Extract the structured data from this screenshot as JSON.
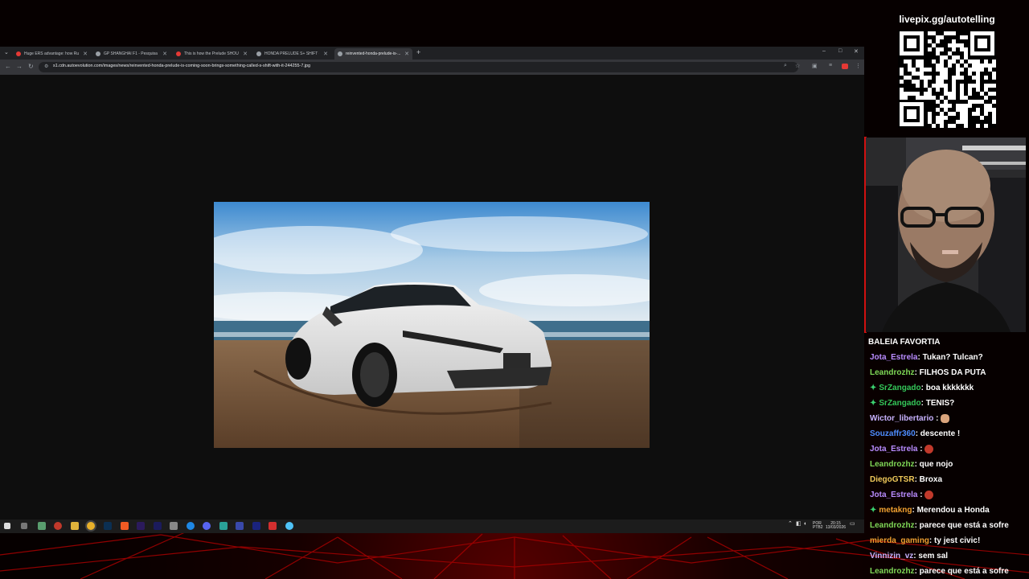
{
  "browser": {
    "tabs": [
      {
        "title": "Huge ERS advantage: how Ru...",
        "fav": "#e53935"
      },
      {
        "title": "GP SHANGHAI F1 - Pesquisa G...",
        "fav": "#9aa0a6"
      },
      {
        "title": "This is how the Prelude SHOU...",
        "fav": "#e53935"
      },
      {
        "title": "HONDA PRELUDE S+ SHIFT - F...",
        "fav": "#9aa0a6"
      },
      {
        "title": "reinvented-honda-prelude-is-...",
        "fav": "#9aa0a6"
      }
    ],
    "new_tab": "+",
    "url": "s1.cdn.autoevolution.com/images/news/reinvented-honda-prelude-is-coming-soon-brings-something-called-s-shift-with-it-244255-7.jpg",
    "window": {
      "minimize": "–",
      "maximize": "□",
      "close": "✕"
    }
  },
  "taskbar": {
    "lang": "POR",
    "lang2": "PTB2",
    "time": "20:15",
    "date": "13/03/2026"
  },
  "overlay": {
    "livepix": "livepix.gg/autotelling"
  },
  "chat": {
    "header": "BALEIA FAVORTIA",
    "messages": [
      {
        "user": "Jota_Estrela",
        "color": "#b98cff",
        "text": ": Tukan? Tulcan?",
        "badge": false,
        "emote": ""
      },
      {
        "user": "Leandrozhz",
        "color": "#7fd957",
        "text": ": FILHOS DA PUTA",
        "badge": false,
        "emote": ""
      },
      {
        "user": "SrZangado",
        "color": "#34c759",
        "text": ": boa kkkkkkk",
        "badge": true,
        "emote": ""
      },
      {
        "user": "SrZangado",
        "color": "#34c759",
        "text": ": TENIS?",
        "badge": true,
        "emote": ""
      },
      {
        "user": "Wictor_libertario",
        "color": "#c9b3ff",
        "text": " :",
        "badge": false,
        "emote": "hand"
      },
      {
        "user": "Souzaffr360",
        "color": "#4e8dff",
        "text": ": descente !",
        "badge": false,
        "emote": ""
      },
      {
        "user": "Jota_Estrela",
        "color": "#b98cff",
        "text": " :",
        "badge": false,
        "emote": "red"
      },
      {
        "user": "Leandrozhz",
        "color": "#7fd957",
        "text": ": que nojo",
        "badge": false,
        "emote": ""
      },
      {
        "user": "DiegoGTSR",
        "color": "#f0c95a",
        "text": ": Broxa",
        "badge": false,
        "emote": ""
      },
      {
        "user": "Jota_Estrela",
        "color": "#b98cff",
        "text": " :",
        "badge": false,
        "emote": "red"
      },
      {
        "user": "metakng",
        "color": "#f0a030",
        "text": ": Merendou a Honda",
        "badge": true,
        "emote": ""
      },
      {
        "user": "Leandrozhz",
        "color": "#7fd957",
        "text": ": parece que está a sofre",
        "badge": false,
        "emote": ""
      },
      {
        "user": "mierda_gaming",
        "color": "#f0a030",
        "text": ": ty jest civic!",
        "badge": false,
        "emote": ""
      },
      {
        "user": "Vinnizin_vz",
        "color": "#c9b3ff",
        "text": ": sem sal",
        "badge": false,
        "emote": ""
      },
      {
        "user": "Leandrozhz",
        "color": "#7fd957",
        "text": ": parece que está a sofre",
        "badge": false,
        "emote": ""
      }
    ]
  },
  "icons": [
    "search-icon",
    "star-icon",
    "extensions-icon",
    "menu-icon",
    "windows-start-icon",
    "chrome-icon"
  ]
}
